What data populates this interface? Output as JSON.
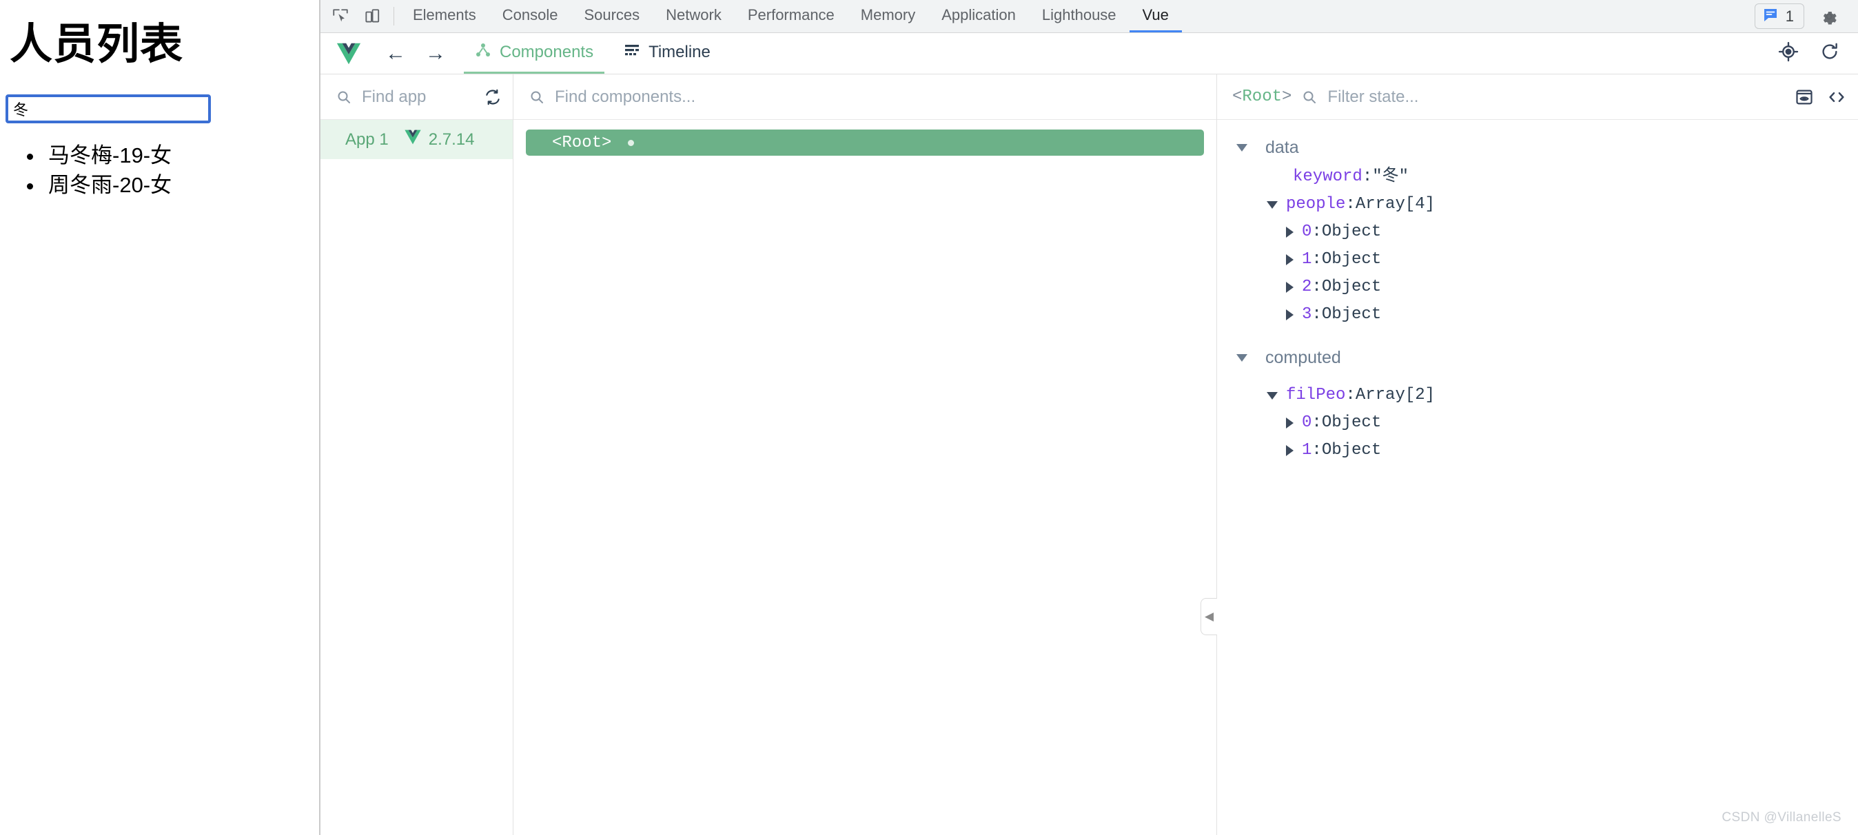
{
  "webpage": {
    "title": "人员列表",
    "search": {
      "value": "冬",
      "placeholder": ""
    },
    "results": [
      "马冬梅-19-女",
      "周冬雨-20-女"
    ]
  },
  "devtools": {
    "tabs": [
      {
        "label": "Elements",
        "active": false
      },
      {
        "label": "Console",
        "active": false
      },
      {
        "label": "Sources",
        "active": false
      },
      {
        "label": "Network",
        "active": false
      },
      {
        "label": "Performance",
        "active": false
      },
      {
        "label": "Memory",
        "active": false
      },
      {
        "label": "Application",
        "active": false
      },
      {
        "label": "Lighthouse",
        "active": false
      },
      {
        "label": "Vue",
        "active": true
      }
    ],
    "icons": {
      "inspect": "inspect-element-icon",
      "device": "device-toolbar-icon",
      "settings": "gear-icon",
      "issues": "message-bubble-icon"
    },
    "issues_count": "1",
    "accent": "#4285f4"
  },
  "vue_panel": {
    "logo": "vue-logo",
    "back_arrow": "←",
    "forward_arrow": "→",
    "tabs": [
      {
        "label": "Components",
        "icon": "component-tree-icon",
        "active": true
      },
      {
        "label": "Timeline",
        "icon": "timeline-icon",
        "active": false
      }
    ],
    "header_actions": [
      {
        "icon": "target-icon"
      },
      {
        "icon": "refresh-icon"
      }
    ],
    "accent": "#65b587",
    "apps": {
      "search_placeholder": "Find app",
      "refresh_icon": "sync-icon",
      "items": [
        {
          "name": "App 1",
          "version": "2.7.14",
          "selected": true
        }
      ]
    },
    "components": {
      "search_placeholder": "Find components...",
      "tree": [
        {
          "label": "<Root>",
          "selected": true,
          "has_dot": true
        }
      ],
      "collapse_handle_icon": "chevron-left-icon"
    },
    "state": {
      "component_name": "<Root>",
      "filter_placeholder": "Filter state...",
      "actions": [
        {
          "icon": "inspect-dom-icon"
        },
        {
          "icon": "open-in-editor-icon"
        }
      ],
      "groups": [
        {
          "title": "data",
          "expanded": true,
          "rows": [
            {
              "indent": 1,
              "arrow": "none",
              "key": "keyword",
              "sep": ": ",
              "value": "\"冬\""
            },
            {
              "indent": 0,
              "arrow": "down",
              "key": "people",
              "sep": ": ",
              "value": "Array[4]"
            },
            {
              "indent": 1,
              "arrow": "right",
              "key": "0",
              "sep": ": ",
              "value": "Object"
            },
            {
              "indent": 1,
              "arrow": "right",
              "key": "1",
              "sep": ": ",
              "value": "Object"
            },
            {
              "indent": 1,
              "arrow": "right",
              "key": "2",
              "sep": ": ",
              "value": "Object"
            },
            {
              "indent": 1,
              "arrow": "right",
              "key": "3",
              "sep": ": ",
              "value": "Object"
            }
          ]
        },
        {
          "title": "computed",
          "expanded": true,
          "rows": [
            {
              "indent": 0,
              "arrow": "down",
              "key": "filPeo",
              "sep": ": ",
              "value": "Array[2]"
            },
            {
              "indent": 1,
              "arrow": "right",
              "key": "0",
              "sep": ": ",
              "value": "Object"
            },
            {
              "indent": 1,
              "arrow": "right",
              "key": "1",
              "sep": ": ",
              "value": "Object"
            }
          ]
        }
      ]
    }
  },
  "watermark": "CSDN @VillanelleS"
}
